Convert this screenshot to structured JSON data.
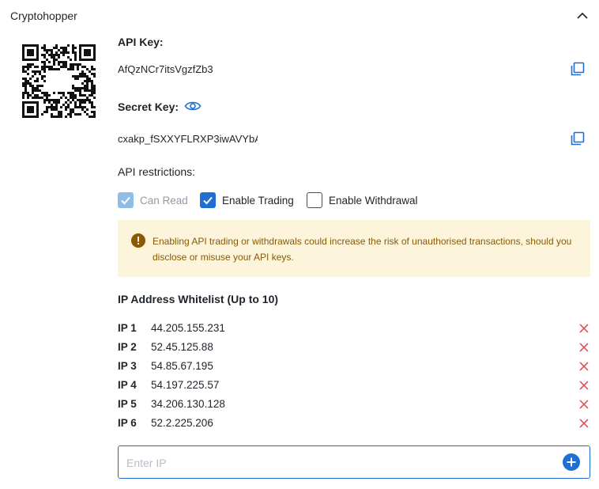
{
  "header": {
    "title": "Cryptohopper",
    "collapse_icon": "chevron-up-icon"
  },
  "api": {
    "api_key_label": "API Key:",
    "api_key_value": "AfQzNCr7itsVgzfZb3",
    "secret_key_label": "Secret Key:",
    "secret_key_value": "cxakp_fSXXYFLRXP3iwAVYbA",
    "copy_icon": "copy-icon",
    "eye_icon": "eye-icon"
  },
  "restrictions": {
    "title": "API restrictions:",
    "options": [
      {
        "label": "Can Read",
        "checked": true,
        "disabled": true
      },
      {
        "label": "Enable Trading",
        "checked": true,
        "disabled": false
      },
      {
        "label": "Enable Withdrawal",
        "checked": false,
        "disabled": false
      }
    ]
  },
  "warning": {
    "text": "Enabling API trading or withdrawals could increase the risk of unauthorised transactions, should you disclose or misuse your API keys."
  },
  "whitelist": {
    "title": "IP Address Whitelist (Up to 10)",
    "items": [
      {
        "label": "IP 1",
        "value": "44.205.155.231"
      },
      {
        "label": "IP 2",
        "value": "52.45.125.88"
      },
      {
        "label": "IP 3",
        "value": "54.85.67.195"
      },
      {
        "label": "IP 4",
        "value": "54.197.225.57"
      },
      {
        "label": "IP 5",
        "value": "34.206.130.128"
      },
      {
        "label": "IP 6",
        "value": "52.2.225.206"
      }
    ],
    "input_placeholder": "Enter IP"
  },
  "colors": {
    "accent": "#1e6fd4",
    "danger": "#e05563",
    "warning_bg": "#fdf4dc",
    "warning_text": "#8a5a00"
  }
}
